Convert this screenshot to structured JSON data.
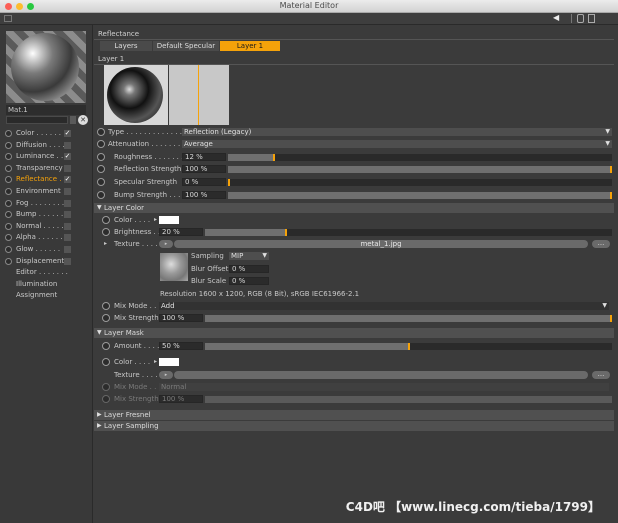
{
  "window": {
    "title": "Material Editor"
  },
  "left": {
    "mat_name": "Mat.1",
    "channels": [
      {
        "label": "Color . . . . . .",
        "checked": true
      },
      {
        "label": "Diffusion . . . .",
        "checked": false
      },
      {
        "label": "Luminance . . .",
        "checked": true
      },
      {
        "label": "Transparency",
        "checked": false
      },
      {
        "label": "Reflectance . .",
        "checked": true,
        "active": true
      },
      {
        "label": "Environment",
        "checked": false
      },
      {
        "label": "Fog . . . . . . . .",
        "checked": false
      },
      {
        "label": "Bump . . . . . .",
        "checked": false
      },
      {
        "label": "Normal . . . . .",
        "checked": false
      },
      {
        "label": "Alpha . . . . . .",
        "checked": false
      },
      {
        "label": "Glow . . . . . .",
        "checked": false
      },
      {
        "label": "Displacement",
        "checked": false
      }
    ],
    "extra": [
      "Editor . . . . . . .",
      "Illumination",
      "Assignment"
    ]
  },
  "reflectance": {
    "title": "Reflectance",
    "tabs": [
      "Layers",
      "Default Specular",
      "Layer 1"
    ],
    "layer_title": "Layer 1",
    "type_label": "Type . . . . . . . . . . . . . .",
    "type_value": "Reflection (Legacy)",
    "atten_label": "Attenuation . . . . . . . . .",
    "atten_value": "Average",
    "roughness_label": "Roughness . . . . . . . .",
    "roughness_value": "12 %",
    "roughness": 0.12,
    "refl_label": "Reflection Strength",
    "refl_value": "100 %",
    "refl": 1.0,
    "spec_label": "Specular Strength",
    "spec_value": "0 %",
    "spec": 0.0,
    "bump_label": "Bump Strength . . . .",
    "bump_value": "100 %",
    "bump": 1.0
  },
  "layer_color": {
    "title": "Layer Color",
    "color_label": "Color . . . .",
    "brightness_label": "Brightness . .",
    "brightness_value": "20 %",
    "brightness": 0.2,
    "texture_label": "Texture . . . .",
    "texture_file": "metal_1.jpg",
    "dots": "...",
    "sampling_label": "Sampling",
    "sampling_value": "MIP",
    "blur_offset_label": "Blur Offset",
    "blur_offset_value": "0 %",
    "blur_scale_label": "Blur Scale",
    "blur_scale_value": "0 %",
    "resolution": "Resolution 1600 x 1200, RGB (8 Bit), sRGB IEC61966-2.1",
    "mix_mode_label": "Mix Mode . . .",
    "mix_mode_value": "Add",
    "mix_strength_label": "Mix Strength",
    "mix_strength_value": "100 %",
    "mix_strength": 1.0
  },
  "layer_mask": {
    "title": "Layer Mask",
    "amount_label": "Amount . . . .",
    "amount_value": "50 %",
    "amount": 0.5,
    "color_label": "Color . . . .",
    "texture_label": "Texture . . . .",
    "dots": "...",
    "mix_mode_label": "Mix Mode . . .",
    "mix_mode_value": "Normal",
    "mix_strength_label": "Mix Strength",
    "mix_strength_value": "100 %"
  },
  "sections": {
    "fresnel": "Layer Fresnel",
    "sampling": "Layer Sampling"
  },
  "watermark": "C4D吧 【www.linecg.com/tieba/1799】",
  "colors": {
    "accent": "#f5a20a",
    "panel": "#3b3b3b"
  }
}
